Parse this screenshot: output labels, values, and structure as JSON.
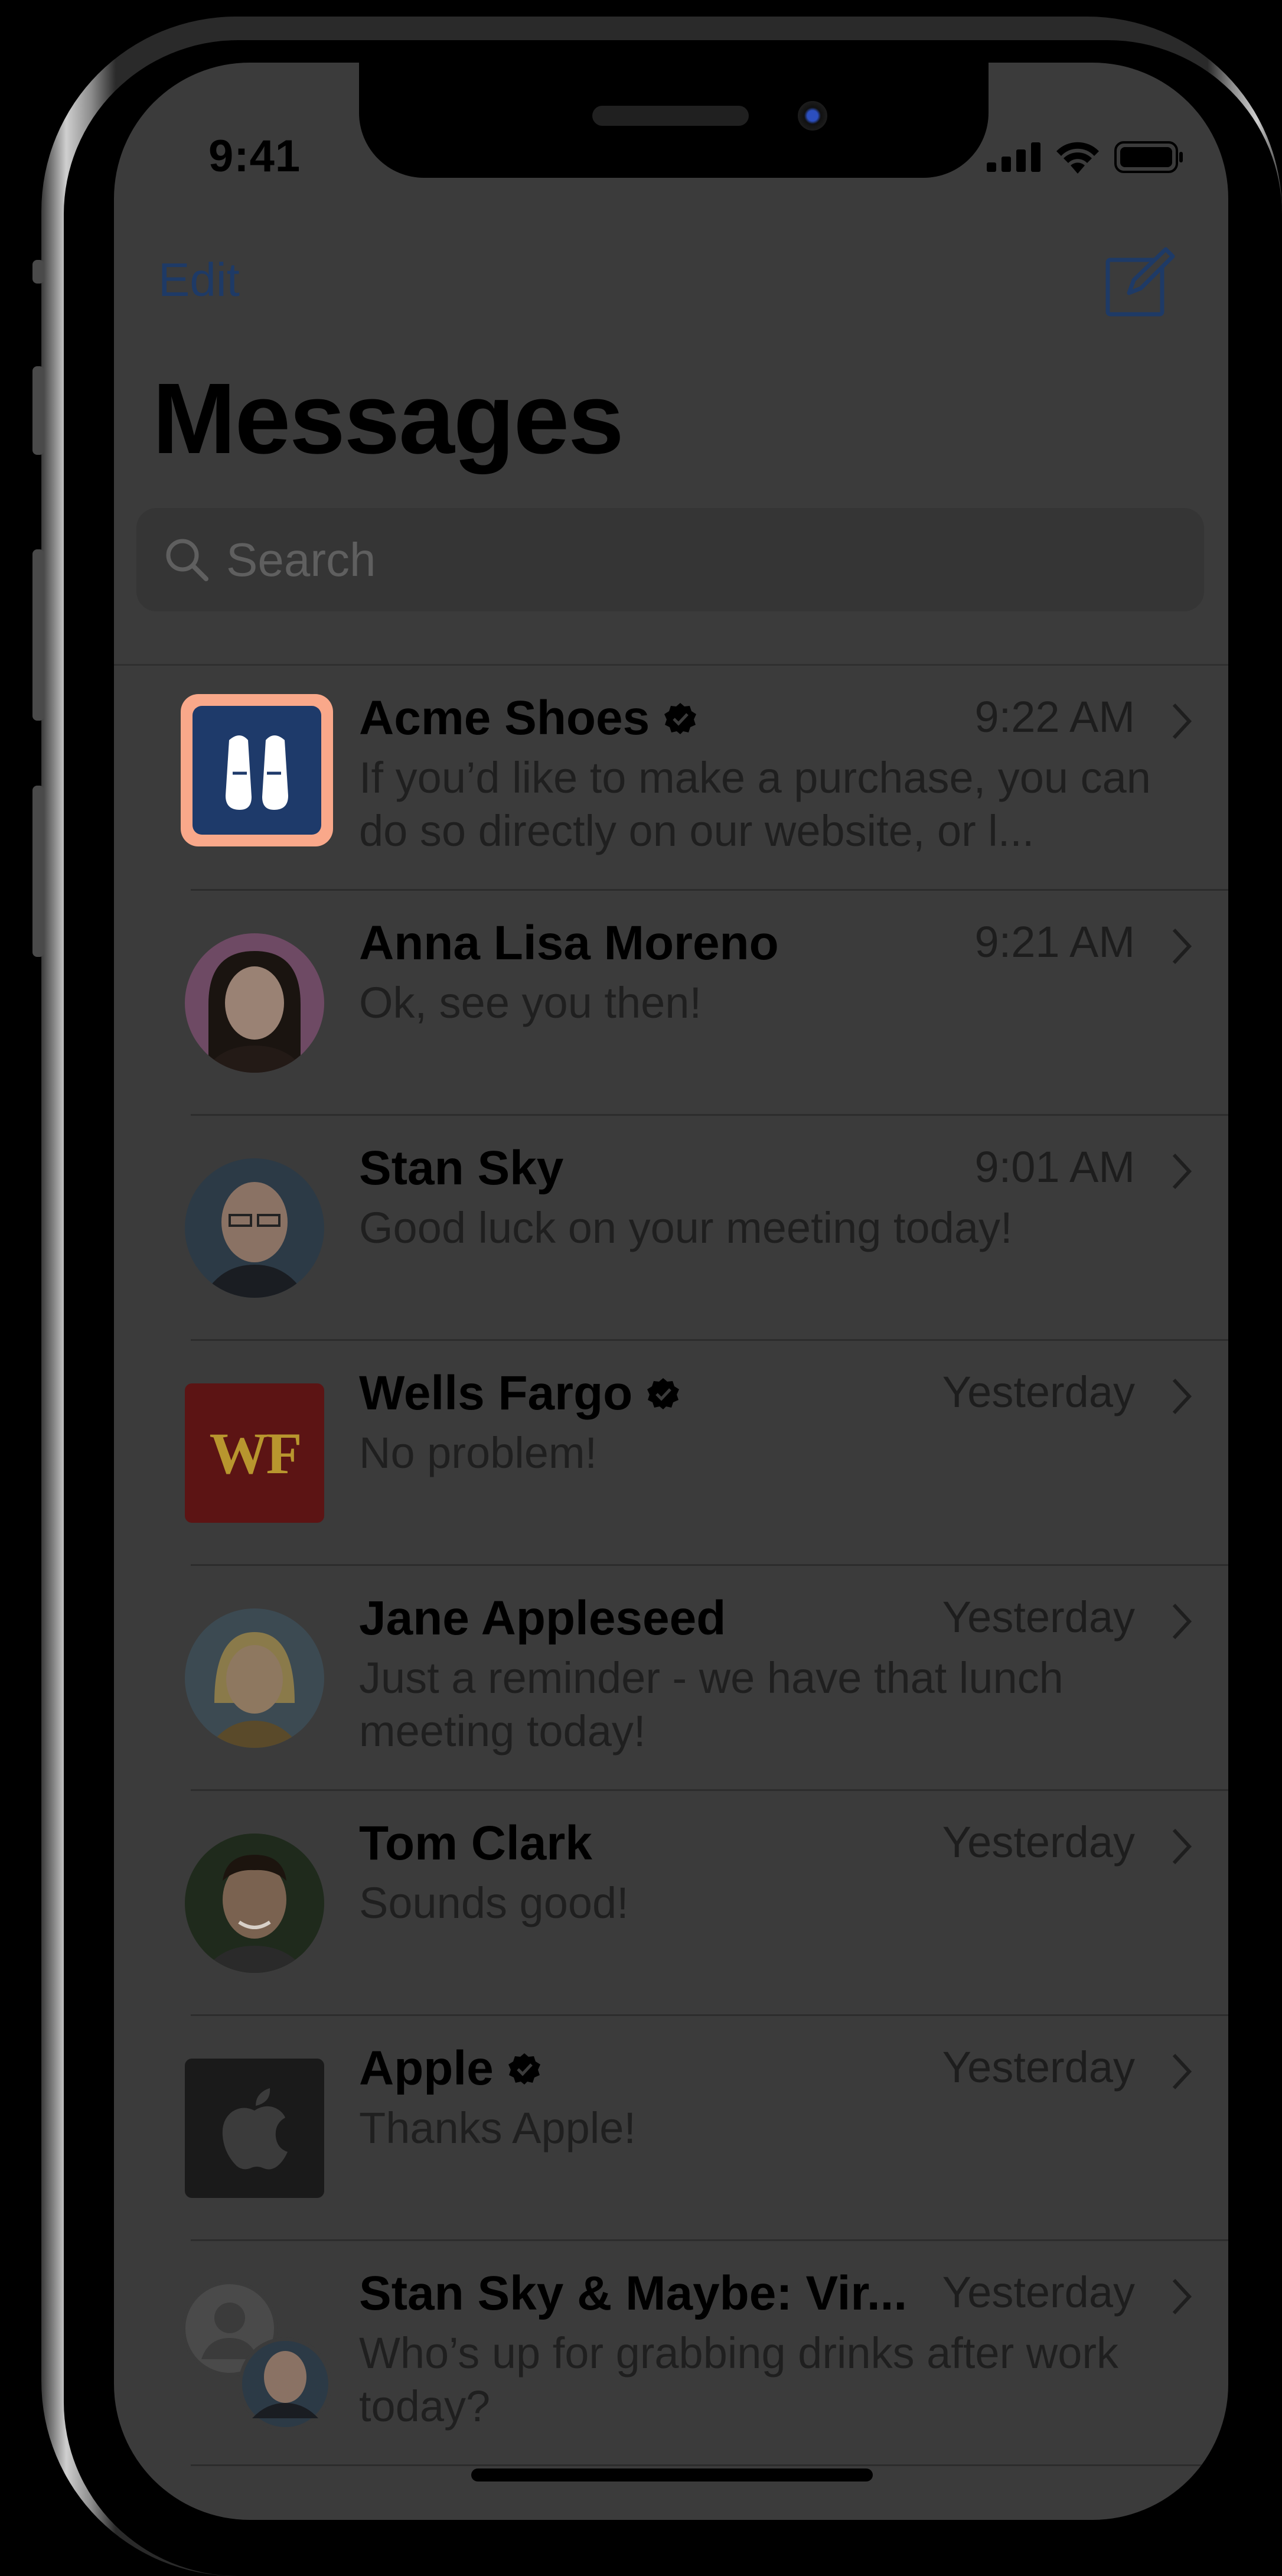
{
  "status_bar": {
    "time": "9:41"
  },
  "nav": {
    "edit": "Edit",
    "title": "Messages"
  },
  "search": {
    "placeholder": "Search"
  },
  "conversations": [
    {
      "name": "Acme Shoes",
      "verified": true,
      "time": "9:22 AM",
      "preview": "If you’d like to make a purchase, you can do so directly on our website, or l..."
    },
    {
      "name": "Anna Lisa Moreno",
      "verified": false,
      "time": "9:21 AM",
      "preview": "Ok, see you then!"
    },
    {
      "name": "Stan Sky",
      "verified": false,
      "time": "9:01 AM",
      "preview": "Good luck on your meeting today!"
    },
    {
      "name": "Wells Fargo",
      "verified": true,
      "time": "Yesterday",
      "preview": "No problem!",
      "logo_text": "WF"
    },
    {
      "name": "Jane Appleseed",
      "verified": false,
      "time": "Yesterday",
      "preview": "Just a reminder - we have that lunch meeting today!"
    },
    {
      "name": "Tom Clark",
      "verified": false,
      "time": "Yesterday",
      "preview": "Sounds good!"
    },
    {
      "name": "Apple",
      "verified": true,
      "time": "Yesterday",
      "preview": "Thanks Apple!"
    },
    {
      "name": "Stan Sky & Maybe: Vir...",
      "verified": false,
      "time": "Yesterday",
      "preview": "Who’s up for grabbing drinks after work today?"
    }
  ],
  "icons": {
    "compose": "compose-icon",
    "search": "search-icon",
    "verified": "verified-badge-icon",
    "chevron": "chevron-right-icon",
    "signal": "cellular-signal-icon",
    "wifi": "wifi-icon",
    "battery": "battery-icon"
  },
  "colors": {
    "dim_overlay": "#3b3b3b",
    "link": "#1e3a66",
    "highlight_border": "#f9a88a",
    "acme_bg": "#1e3a6a",
    "wf_bg": "#5c1414",
    "wf_text": "#b8962e"
  }
}
